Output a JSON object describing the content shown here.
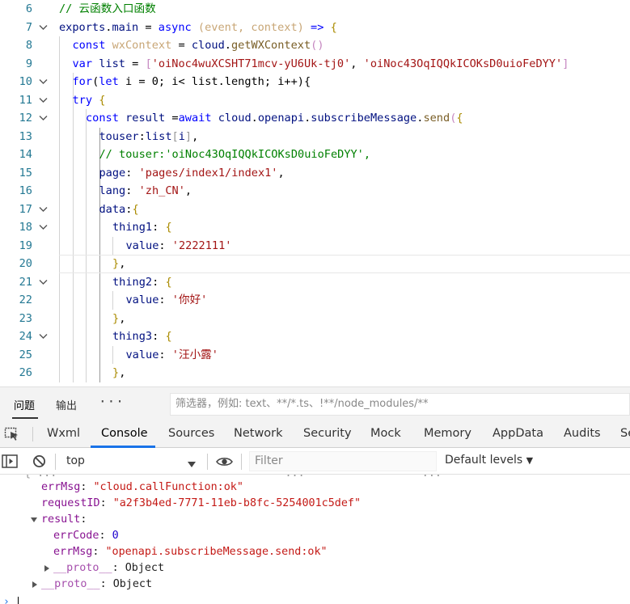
{
  "editor": {
    "lines": [
      {
        "n": "6",
        "fold": false,
        "tokens": [
          [
            "cm",
            "// 云函数入口函数"
          ]
        ]
      },
      {
        "n": "7",
        "fold": true,
        "tokens": [
          [
            "id",
            "exports"
          ],
          [
            "pl",
            "."
          ],
          [
            "id",
            "main"
          ],
          [
            "pl",
            " = "
          ],
          [
            "kw",
            "async"
          ],
          [
            "pl",
            " "
          ],
          [
            "pa",
            "(event, context)"
          ],
          [
            "pl",
            " "
          ],
          [
            "kw",
            "=>"
          ],
          [
            "pl",
            " "
          ],
          [
            "br",
            "{"
          ]
        ]
      },
      {
        "n": "8",
        "fold": false,
        "tokens": [
          [
            "kw",
            "const"
          ],
          [
            "pl",
            " "
          ],
          [
            "pa",
            "wxContext"
          ],
          [
            "pl",
            " = "
          ],
          [
            "id",
            "cloud"
          ],
          [
            "pl",
            "."
          ],
          [
            "fn",
            "getWXContext"
          ],
          [
            "br2",
            "()"
          ]
        ]
      },
      {
        "n": "9",
        "fold": false,
        "tokens": [
          [
            "kw",
            "var"
          ],
          [
            "pl",
            " "
          ],
          [
            "id",
            "list"
          ],
          [
            "pl",
            " = "
          ],
          [
            "br2",
            "["
          ],
          [
            "st",
            "'oiNoc4wuXCSHT71mcv-yU6Uk-tj0'"
          ],
          [
            "pl",
            ", "
          ],
          [
            "st",
            "'oiNoc43OqIQQkICOKsD0uioFeDYY'"
          ],
          [
            "br2",
            "]"
          ]
        ]
      },
      {
        "n": "10",
        "fold": true,
        "tokens": [
          [
            "kw",
            "for"
          ],
          [
            "pl",
            "("
          ],
          [
            "kw",
            "let"
          ],
          [
            "pl",
            " i = "
          ],
          [
            "pl",
            "0"
          ],
          [
            "pl",
            "; i< list.length; i++){"
          ]
        ]
      },
      {
        "n": "11",
        "fold": true,
        "tokens": [
          [
            "kw",
            "try"
          ],
          [
            "pl",
            " "
          ],
          [
            "br",
            "{"
          ]
        ]
      },
      {
        "n": "12",
        "fold": true,
        "tokens": [
          [
            "kw",
            "const"
          ],
          [
            "pl",
            " "
          ],
          [
            "id",
            "result"
          ],
          [
            "pl",
            " ="
          ],
          [
            "kw",
            "await"
          ],
          [
            "pl",
            " "
          ],
          [
            "id",
            "cloud"
          ],
          [
            "pl",
            "."
          ],
          [
            "id",
            "openapi"
          ],
          [
            "pl",
            "."
          ],
          [
            "id",
            "subscribeMessage"
          ],
          [
            "pl",
            "."
          ],
          [
            "fn",
            "send"
          ],
          [
            "br2",
            "("
          ],
          [
            "br",
            "{"
          ]
        ]
      },
      {
        "n": "13",
        "fold": false,
        "tokens": [
          [
            "id",
            "touser"
          ],
          [
            "pl",
            ":"
          ],
          [
            "id",
            "list"
          ],
          [
            "gr",
            "["
          ],
          [
            "id",
            "i"
          ],
          [
            "gr",
            "]"
          ],
          [
            "pl",
            ","
          ]
        ]
      },
      {
        "n": "14",
        "fold": false,
        "tokens": [
          [
            "cm",
            "// touser:'oiNoc43OqIQQkICOKsD0uioFeDYY',"
          ]
        ]
      },
      {
        "n": "15",
        "fold": false,
        "tokens": [
          [
            "id",
            "page"
          ],
          [
            "pl",
            ": "
          ],
          [
            "st",
            "'pages/index1/index1'"
          ],
          [
            "pl",
            ","
          ]
        ]
      },
      {
        "n": "16",
        "fold": false,
        "tokens": [
          [
            "id",
            "lang"
          ],
          [
            "pl",
            ": "
          ],
          [
            "st",
            "'zh_CN'"
          ],
          [
            "pl",
            ","
          ]
        ]
      },
      {
        "n": "17",
        "fold": true,
        "tokens": [
          [
            "id",
            "data"
          ],
          [
            "pl",
            ":"
          ],
          [
            "br",
            "{"
          ]
        ]
      },
      {
        "n": "18",
        "fold": true,
        "tokens": [
          [
            "id",
            "thing1"
          ],
          [
            "pl",
            ": "
          ],
          [
            "br",
            "{"
          ]
        ]
      },
      {
        "n": "19",
        "fold": false,
        "tokens": [
          [
            "id",
            "value"
          ],
          [
            "pl",
            ": "
          ],
          [
            "st",
            "'2222111'"
          ]
        ]
      },
      {
        "n": "20",
        "fold": false,
        "tokens": [
          [
            "br",
            "}"
          ],
          [
            "pl",
            ","
          ]
        ]
      },
      {
        "n": "21",
        "fold": true,
        "tokens": [
          [
            "id",
            "thing2"
          ],
          [
            "pl",
            ": "
          ],
          [
            "br",
            "{"
          ]
        ]
      },
      {
        "n": "22",
        "fold": false,
        "tokens": [
          [
            "id",
            "value"
          ],
          [
            "pl",
            ": "
          ],
          [
            "st",
            "'你好'"
          ]
        ]
      },
      {
        "n": "23",
        "fold": false,
        "tokens": [
          [
            "br",
            "}"
          ],
          [
            "pl",
            ","
          ]
        ]
      },
      {
        "n": "24",
        "fold": true,
        "tokens": [
          [
            "id",
            "thing3"
          ],
          [
            "pl",
            ": "
          ],
          [
            "br",
            "{"
          ]
        ]
      },
      {
        "n": "25",
        "fold": false,
        "tokens": [
          [
            "id",
            "value"
          ],
          [
            "pl",
            ": "
          ],
          [
            "st",
            "'汪小露'"
          ]
        ]
      },
      {
        "n": "26",
        "fold": false,
        "tokens": [
          [
            "br",
            "}"
          ],
          [
            "pl",
            ","
          ]
        ]
      }
    ]
  },
  "panel": {
    "tab_problems": "问题",
    "tab_output": "输出",
    "more": "···",
    "filter_placeholder": "筛选器，例如: text、**/*.ts、!**/node_modules/**"
  },
  "devtools": {
    "tabs": [
      "Wxml",
      "Console",
      "Sources",
      "Network",
      "Security",
      "Mock",
      "Memory",
      "AppData",
      "Audits",
      "Se"
    ],
    "active_tab": "Console"
  },
  "console_toolbar": {
    "context": "top",
    "filter_placeholder": "Filter",
    "levels": "Default levels"
  },
  "console": {
    "cutoff_line": "{ ...                                   ...                  ...",
    "errMsg_key": "errMsg",
    "errMsg_val": "\"cloud.callFunction:ok\"",
    "requestID_key": "requestID",
    "requestID_val": "\"a2f3b4ed-7771-11eb-b8fc-5254001c5def\"",
    "result_key": "result",
    "errCode_key": "errCode",
    "errCode_val": "0",
    "result_errMsg_key": "errMsg",
    "result_errMsg_val": "\"openapi.subscribeMessage.send:ok\"",
    "proto_key": "__proto__",
    "proto_val": "Object"
  }
}
